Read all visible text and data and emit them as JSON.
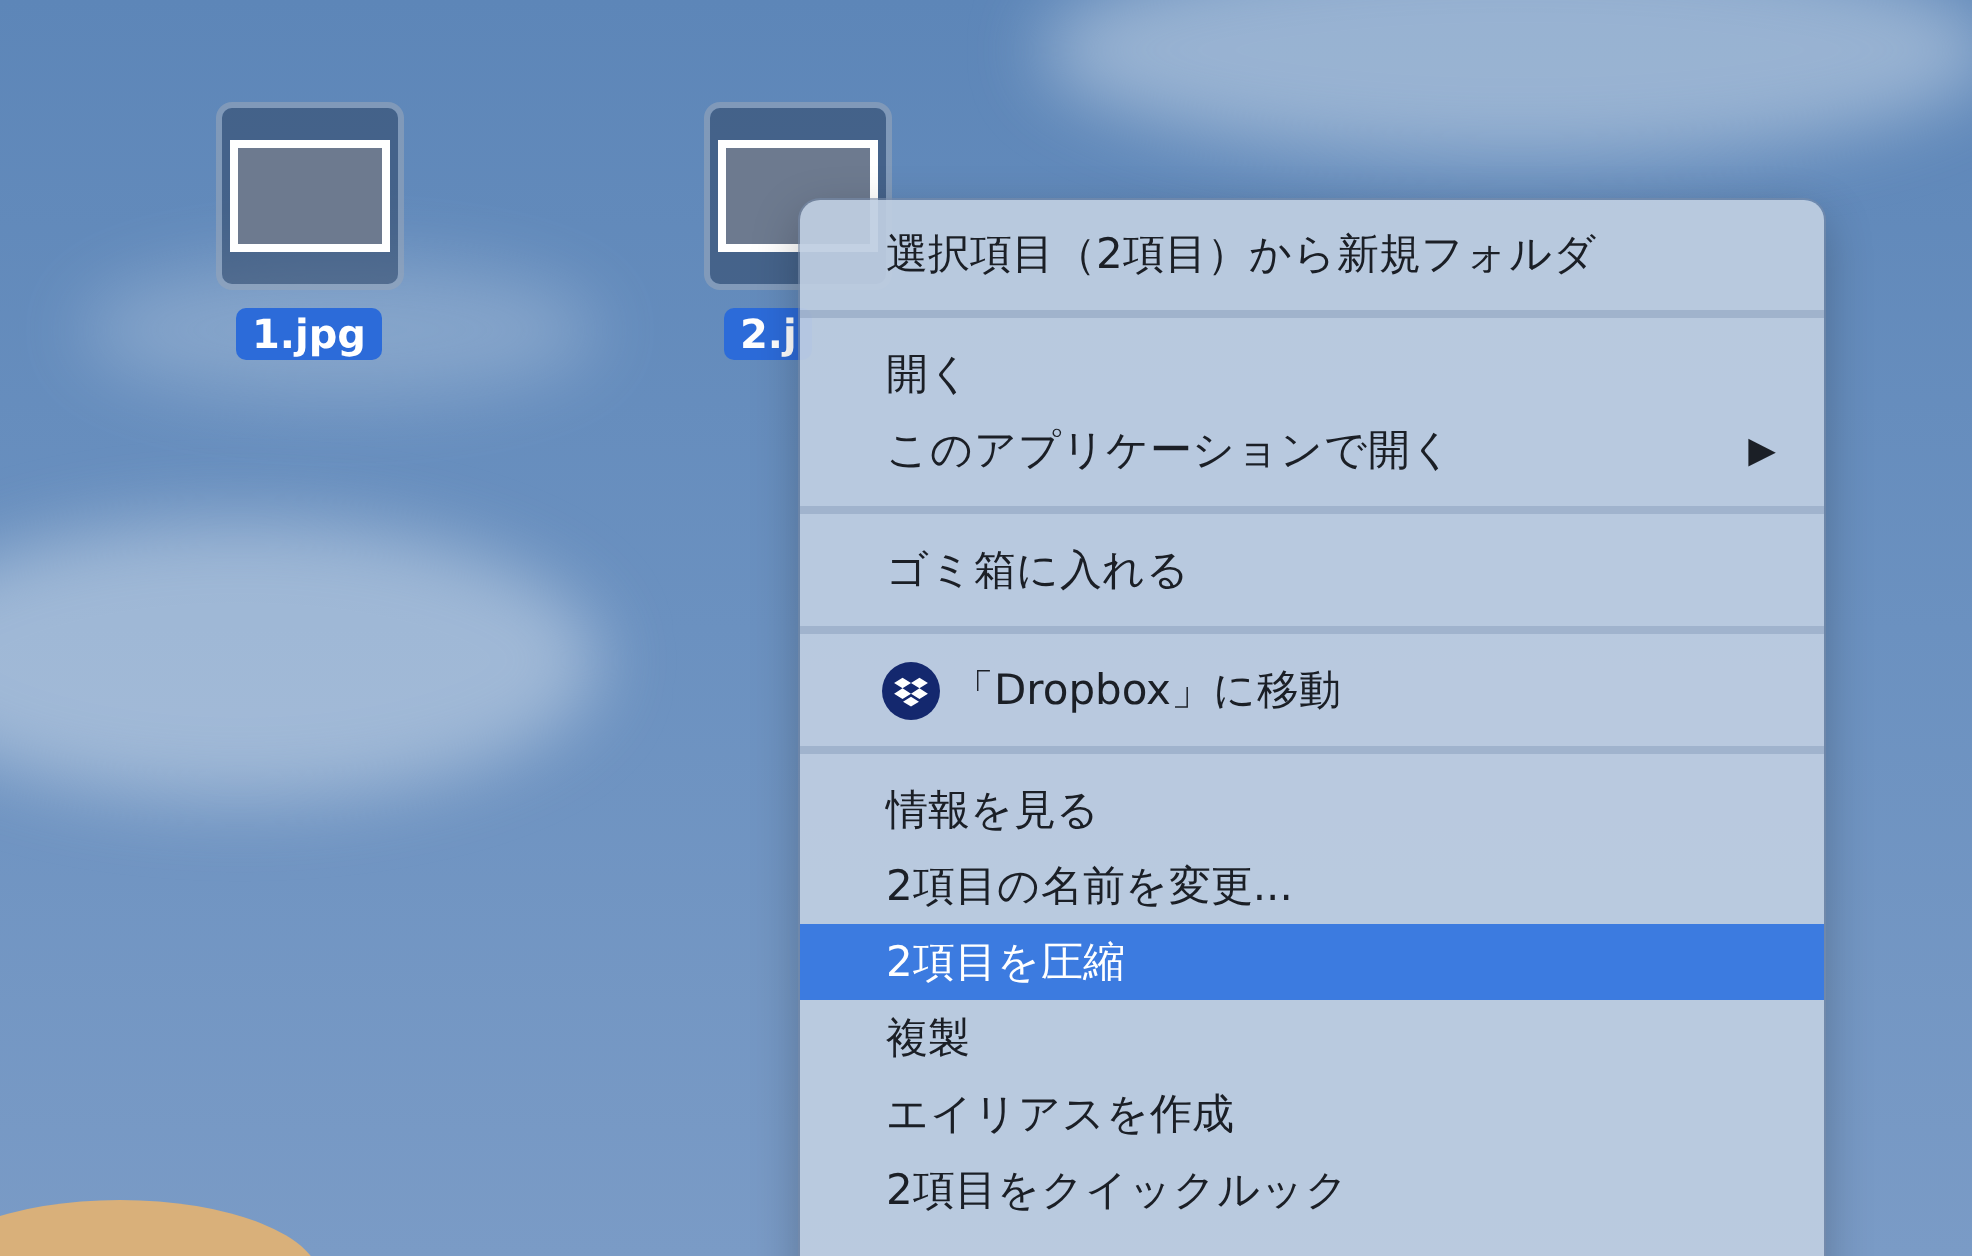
{
  "desktop_files": [
    {
      "name": "1.jpg",
      "selected": true
    },
    {
      "name": "2.j",
      "selected": true
    }
  ],
  "context_menu": {
    "sections": [
      {
        "items": [
          {
            "label": "選択項目（2項目）から新規フォルダ",
            "kind": "plain",
            "selected": false
          }
        ]
      },
      {
        "items": [
          {
            "label": "開く",
            "kind": "plain",
            "selected": false
          },
          {
            "label": "このアプリケーションで開く",
            "kind": "submenu",
            "arrow": "▶",
            "selected": false
          }
        ]
      },
      {
        "items": [
          {
            "label": "ゴミ箱に入れる",
            "kind": "plain",
            "selected": false
          }
        ]
      },
      {
        "items": [
          {
            "label": "「Dropbox」に移動",
            "kind": "icon",
            "selected": false
          }
        ]
      },
      {
        "items": [
          {
            "label": "情報を見る",
            "kind": "plain",
            "selected": false
          },
          {
            "label": "2項目の名前を変更...",
            "kind": "plain",
            "selected": false
          },
          {
            "label": "2項目を圧縮",
            "kind": "plain",
            "selected": true
          },
          {
            "label": "複製",
            "kind": "plain",
            "selected": false
          },
          {
            "label": "エイリアスを作成",
            "kind": "plain",
            "selected": false
          },
          {
            "label": "2項目をクイックルック",
            "kind": "plain",
            "selected": false
          }
        ]
      }
    ]
  }
}
